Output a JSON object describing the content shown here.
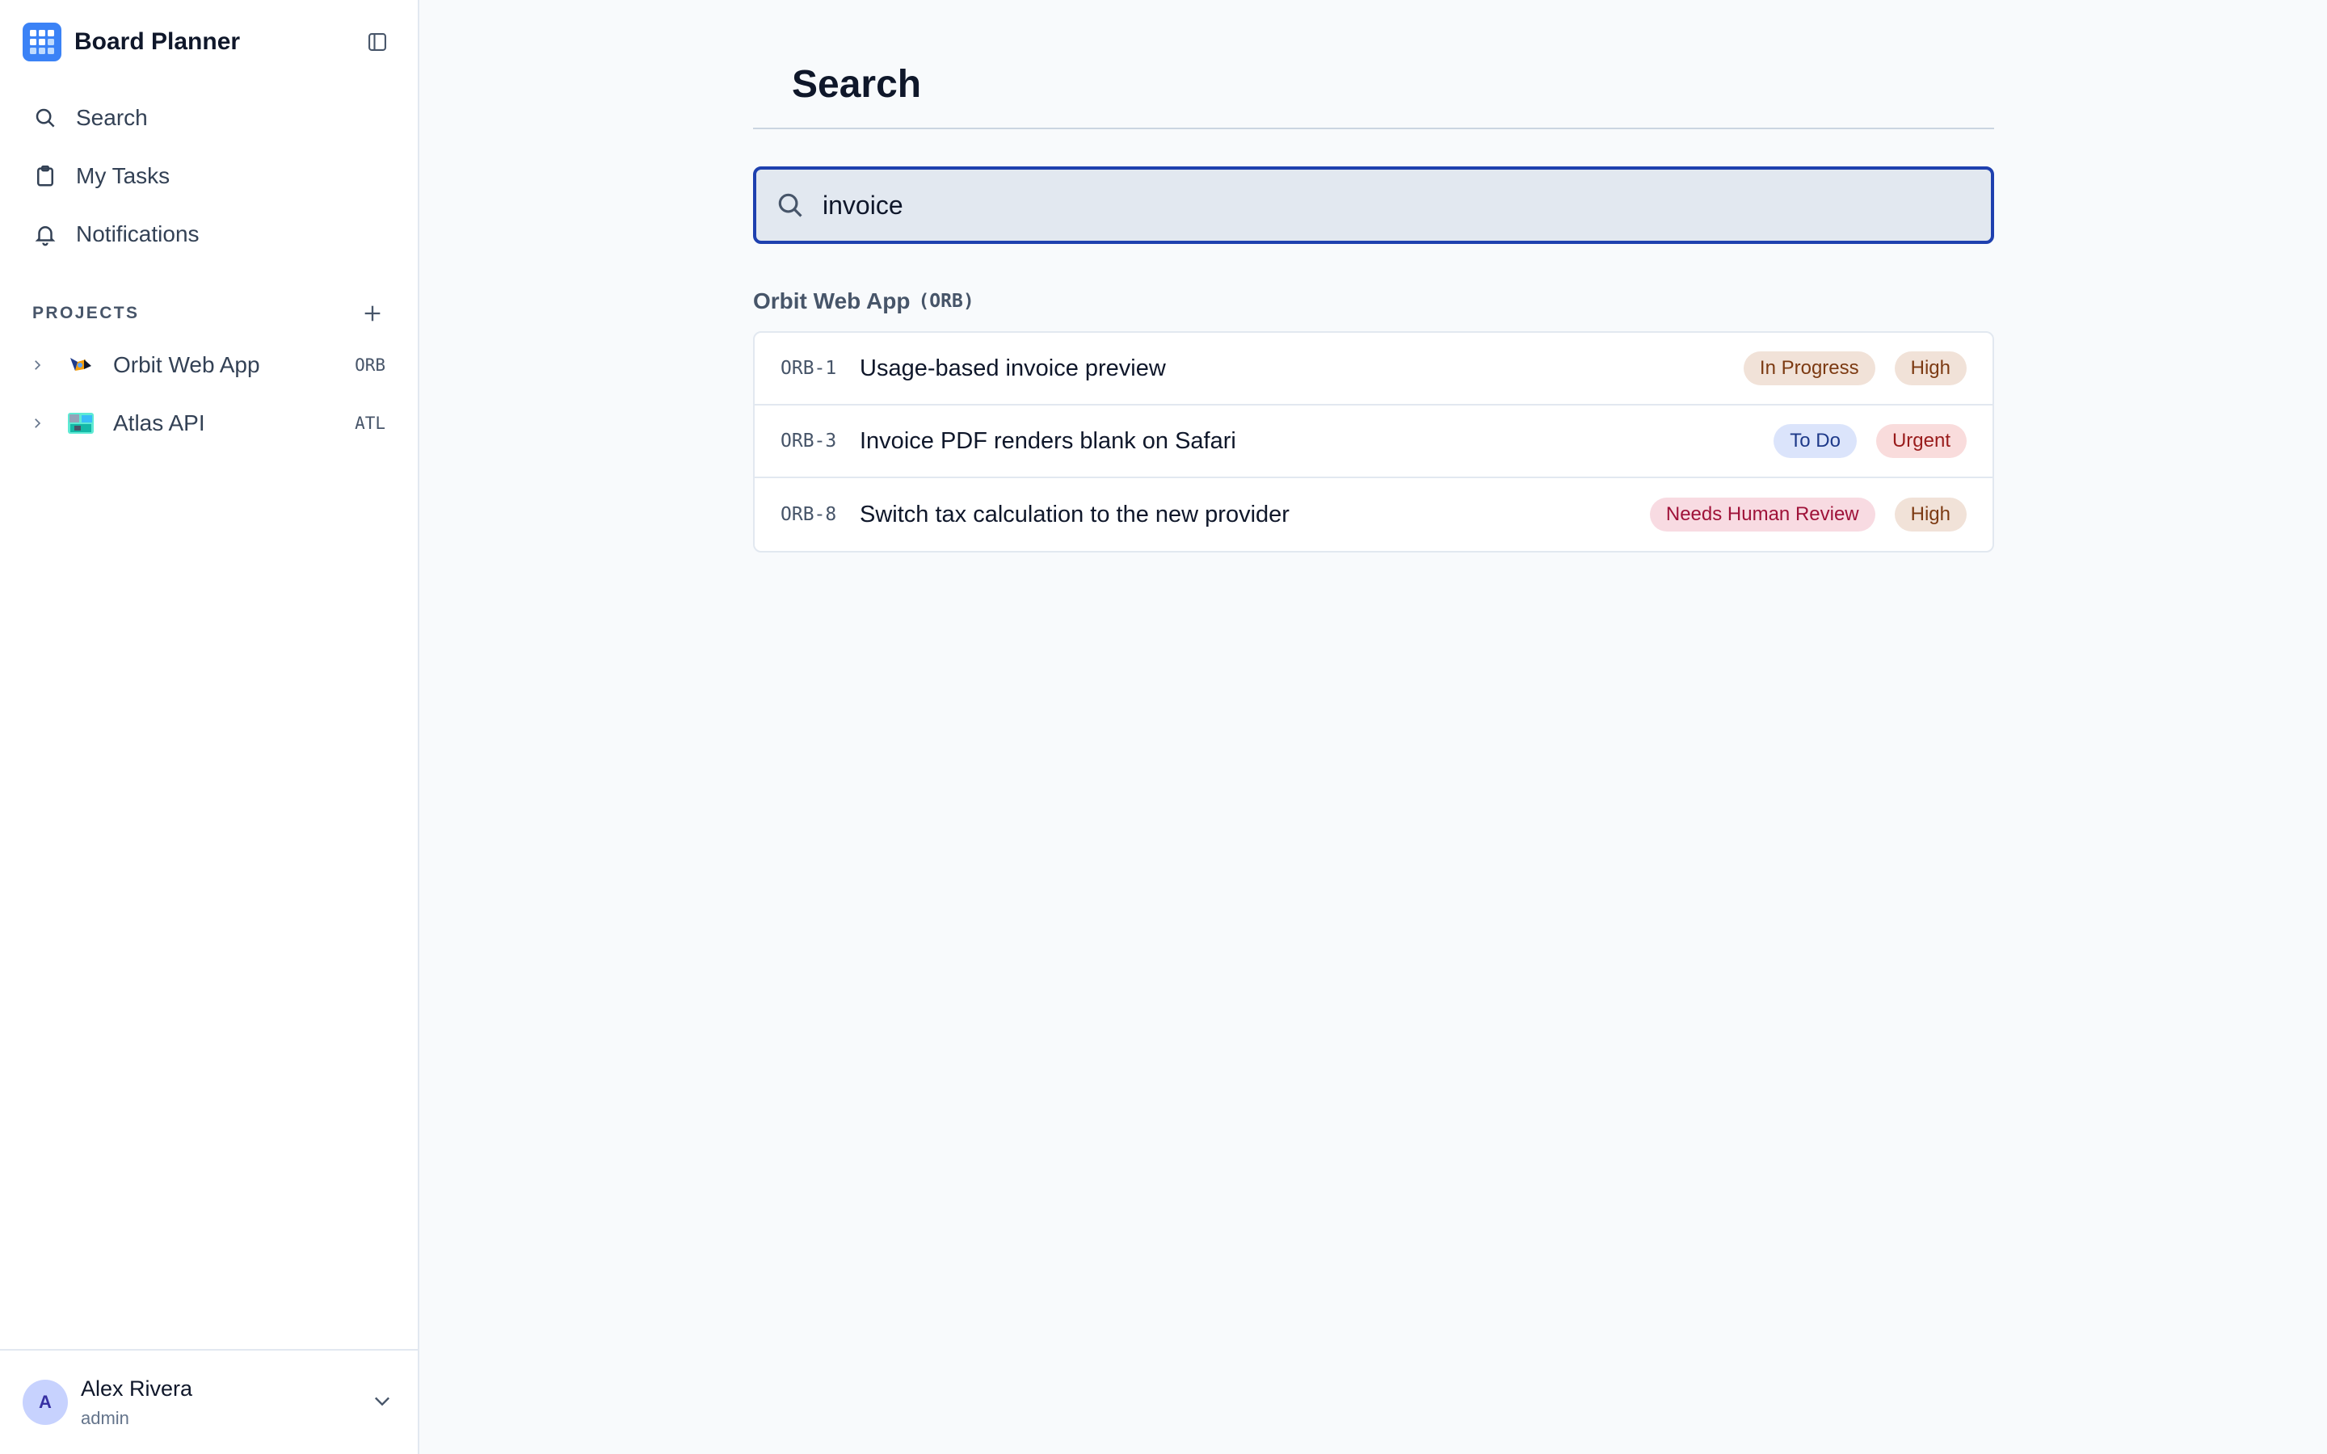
{
  "app": {
    "name": "Board Planner"
  },
  "nav": {
    "items": [
      {
        "label": "Search",
        "icon": "search-icon"
      },
      {
        "label": "My Tasks",
        "icon": "clipboard-icon"
      },
      {
        "label": "Notifications",
        "icon": "bell-icon"
      }
    ]
  },
  "projects": {
    "label": "PROJECTS",
    "items": [
      {
        "name": "Orbit Web App",
        "key": "ORB",
        "icon": "project-image-icon"
      },
      {
        "name": "Atlas API",
        "key": "ATL",
        "icon": "project-image-icon"
      }
    ]
  },
  "user": {
    "initial": "A",
    "name": "Alex Rivera",
    "role": "admin"
  },
  "page": {
    "title": "Search"
  },
  "search": {
    "query": "invoice"
  },
  "results": {
    "group_name": "Orbit Web App",
    "group_key": "(ORB)",
    "items": [
      {
        "key": "ORB-1",
        "title": "Usage-based invoice preview",
        "status": "In Progress",
        "priority": "High",
        "status_colors": {
          "bg": "#f1e2d8",
          "fg": "#7c3a12"
        },
        "priority_colors": {
          "bg": "#f1e2d8",
          "fg": "#7c3a12"
        }
      },
      {
        "key": "ORB-3",
        "title": "Invoice PDF renders blank on Safari",
        "status": "To Do",
        "priority": "Urgent",
        "status_colors": {
          "bg": "#dbe4fb",
          "fg": "#1e3a8a"
        },
        "priority_colors": {
          "bg": "#f9dcdc",
          "fg": "#991b1b"
        }
      },
      {
        "key": "ORB-8",
        "title": "Switch tax calculation to the new provider",
        "status": "Needs Human Review",
        "priority": "High",
        "status_colors": {
          "bg": "#f8dbe2",
          "fg": "#9f1239"
        },
        "priority_colors": {
          "bg": "#f1e2d8",
          "fg": "#7c3a12"
        }
      }
    ]
  },
  "colors": {
    "accent": "#3b82f6",
    "focus_ring": "#1e40af"
  }
}
